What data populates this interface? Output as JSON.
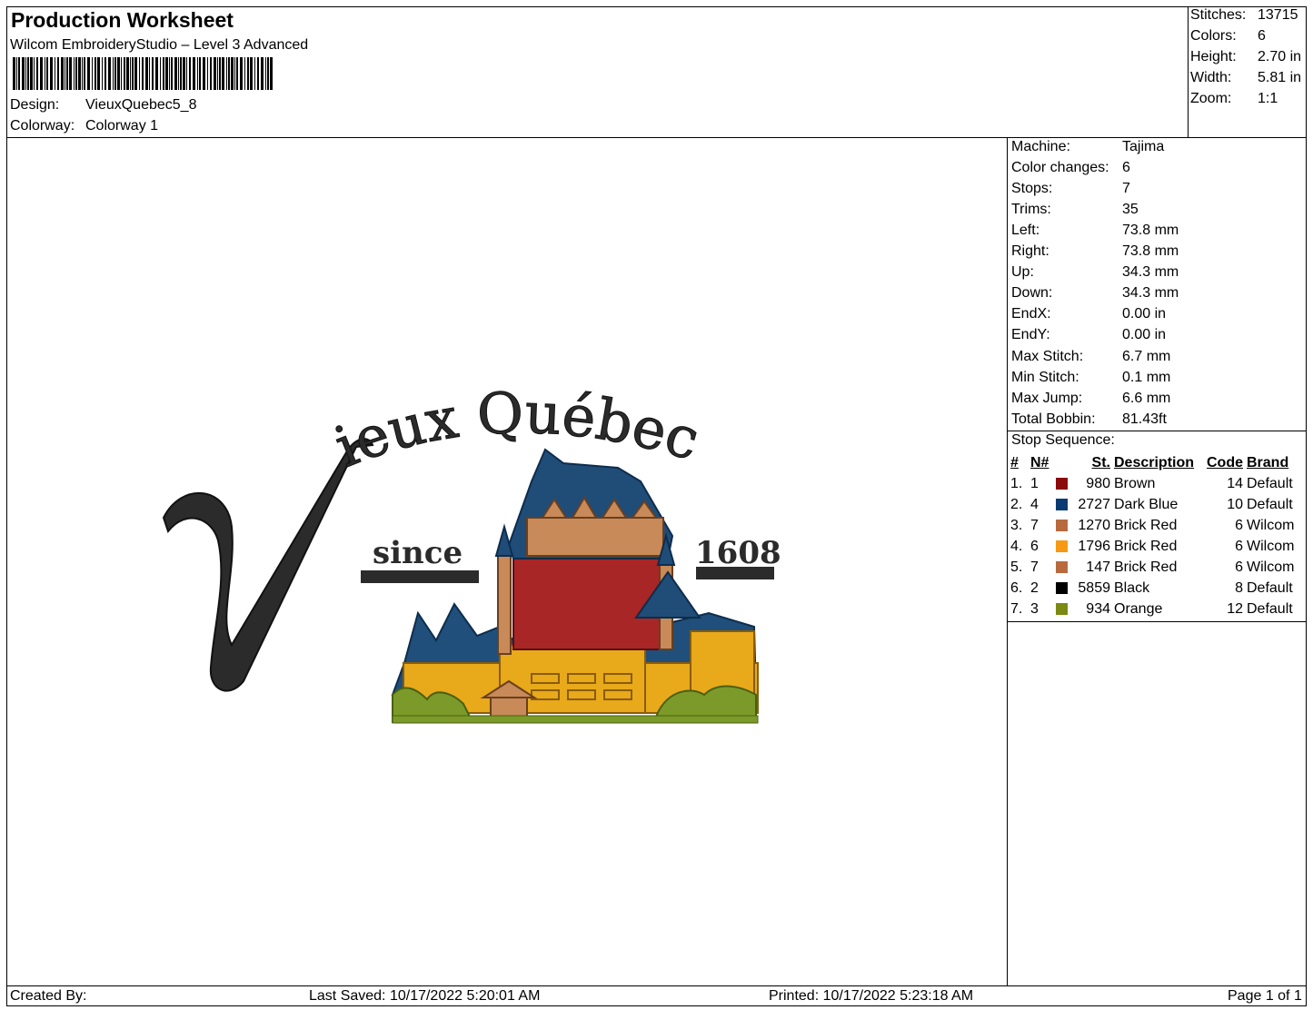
{
  "header": {
    "title": "Production Worksheet",
    "software": "Wilcom EmbroideryStudio – Level 3 Advanced",
    "design_label": "Design:",
    "design_value": "VieuxQuebec5_8",
    "colorway_label": "Colorway:",
    "colorway_value": "Colorway 1"
  },
  "summary": [
    {
      "label": "Stitches:",
      "value": "13715"
    },
    {
      "label": "Colors:",
      "value": "6"
    },
    {
      "label": "Height:",
      "value": "2.70 in"
    },
    {
      "label": "Width:",
      "value": "5.81 in"
    },
    {
      "label": "Zoom:",
      "value": "1:1"
    }
  ],
  "details": [
    {
      "label": "Machine:",
      "value": "Tajima"
    },
    {
      "label": "Color changes:",
      "value": "6"
    },
    {
      "label": "Stops:",
      "value": "7"
    },
    {
      "label": "Trims:",
      "value": "35"
    },
    {
      "label": "Left:",
      "value": "73.8 mm"
    },
    {
      "label": "Right:",
      "value": "73.8 mm"
    },
    {
      "label": "Up:",
      "value": "34.3 mm"
    },
    {
      "label": "Down:",
      "value": "34.3 mm"
    },
    {
      "label": "EndX:",
      "value": "0.00 in"
    },
    {
      "label": "EndY:",
      "value": "0.00 in"
    },
    {
      "label": "Max Stitch:",
      "value": "6.7 mm"
    },
    {
      "label": "Min Stitch:",
      "value": "0.1 mm"
    },
    {
      "label": "Max Jump:",
      "value": "6.6 mm"
    },
    {
      "label": "Total Bobbin:",
      "value": "81.43ft"
    }
  ],
  "stop_sequence": {
    "title": "Stop Sequence:",
    "headers": [
      "#",
      "N#",
      "St.",
      "Description",
      "Code",
      "Brand"
    ],
    "rows": [
      {
        "idx": "1.",
        "n": "1",
        "color": "#8B0A0A",
        "st": "980",
        "desc": "Brown",
        "code": "14",
        "brand": "Default"
      },
      {
        "idx": "2.",
        "n": "4",
        "color": "#0A3A72",
        "st": "2727",
        "desc": "Dark Blue",
        "code": "10",
        "brand": "Default"
      },
      {
        "idx": "3.",
        "n": "7",
        "color": "#B86A3E",
        "st": "1270",
        "desc": "Brick Red",
        "code": "6",
        "brand": "Wilcom"
      },
      {
        "idx": "4.",
        "n": "6",
        "color": "#F59A12",
        "st": "1796",
        "desc": "Brick Red",
        "code": "6",
        "brand": "Wilcom"
      },
      {
        "idx": "5.",
        "n": "7",
        "color": "#B86A3E",
        "st": "147",
        "desc": "Brick Red",
        "code": "6",
        "brand": "Wilcom"
      },
      {
        "idx": "6.",
        "n": "2",
        "color": "#000000",
        "st": "5859",
        "desc": "Black",
        "code": "8",
        "brand": "Default"
      },
      {
        "idx": "7.",
        "n": "3",
        "color": "#7A8A12",
        "st": "934",
        "desc": "Orange",
        "code": "12",
        "brand": "Default"
      }
    ]
  },
  "design": {
    "line1": "Vieux Québec",
    "since": "since",
    "year": "1608"
  },
  "footer": {
    "created_by": "Created By:",
    "last_saved": "Last Saved: 10/17/2022 5:20:01 AM",
    "printed": "Printed: 10/17/2022 5:23:18 AM",
    "page": "Page 1 of 1"
  }
}
